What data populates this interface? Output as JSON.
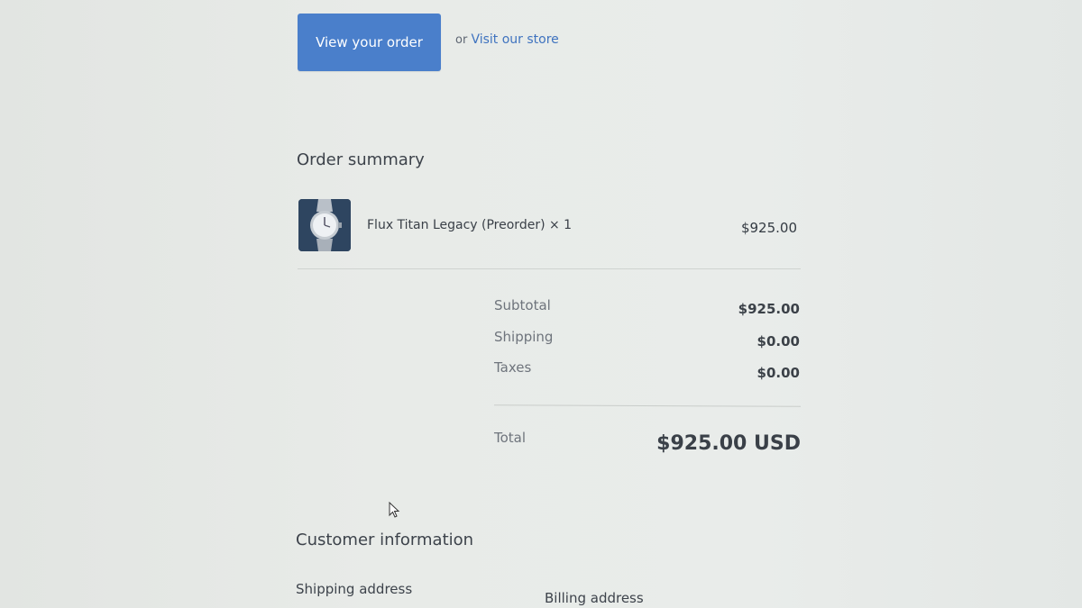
{
  "actions": {
    "view_order_label": "View your order",
    "or_text": "or",
    "visit_store_label": "Visit our store"
  },
  "order_summary": {
    "heading": "Order summary",
    "items": [
      {
        "name": "Flux Titan Legacy (Preorder) × 1",
        "price": "$925.00",
        "thumbnail_icon": "watch-icon"
      }
    ],
    "rows": [
      {
        "label": "Subtotal",
        "value": "$925.00"
      },
      {
        "label": "Shipping",
        "value": "$0.00"
      },
      {
        "label": "Taxes",
        "value": "$0.00"
      }
    ],
    "total_label": "Total",
    "total_value": "$925.00 USD"
  },
  "customer_information": {
    "heading": "Customer information",
    "shipping_address_label": "Shipping address",
    "billing_address_label": "Billing address"
  },
  "colors": {
    "button": "#4a7fcb",
    "link": "#3f73bf",
    "background": "#e8ebe8"
  }
}
